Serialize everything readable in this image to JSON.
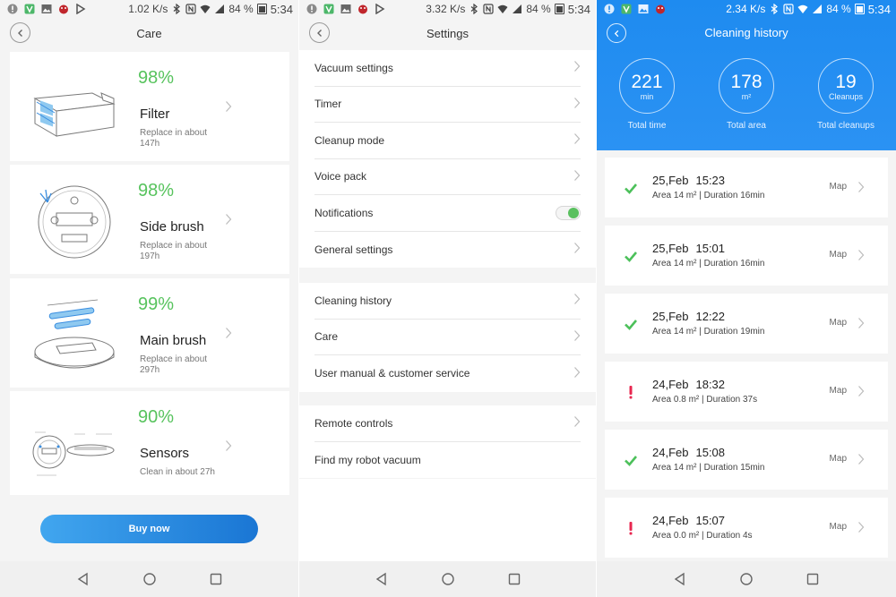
{
  "status_bars": [
    {
      "speed": "1.02 K/s",
      "battery": "84 %",
      "time": "5:34"
    },
    {
      "speed": "3.32 K/s",
      "battery": "84 %",
      "time": "5:34"
    },
    {
      "speed": "2.34 K/s",
      "battery": "84 %",
      "time": "5:34"
    }
  ],
  "care": {
    "title": "Care",
    "items": [
      {
        "percent": "98%",
        "name": "Filter",
        "sub": "Replace in about 147h"
      },
      {
        "percent": "98%",
        "name": "Side brush",
        "sub": "Replace in about 197h"
      },
      {
        "percent": "99%",
        "name": "Main brush",
        "sub": "Replace in about 297h"
      },
      {
        "percent": "90%",
        "name": "Sensors",
        "sub": "Clean in about 27h"
      }
    ],
    "buy_label": "Buy now"
  },
  "settings": {
    "title": "Settings",
    "groups": [
      [
        "Vacuum settings",
        "Timer",
        "Cleanup mode",
        "Voice pack",
        "Notifications",
        "General settings"
      ],
      [
        "Cleaning history",
        "Care",
        "User manual & customer service"
      ],
      [
        "Remote controls",
        "Find my robot vacuum"
      ]
    ],
    "notifications_on": true
  },
  "history": {
    "title": "Cleaning history",
    "stats": [
      {
        "value": "221",
        "unit": "min",
        "caption": "Total time"
      },
      {
        "value": "178",
        "unit": "m²",
        "caption": "Total area"
      },
      {
        "value": "19",
        "unit": "Cleanups",
        "caption": "Total cleanups"
      }
    ],
    "entries": [
      {
        "date": "25,Feb",
        "time": "15:23",
        "meta": "Area 14 m²  |  Duration 16min",
        "status": "ok",
        "map": "Map"
      },
      {
        "date": "25,Feb",
        "time": "15:01",
        "meta": "Area 14 m²  |  Duration 16min",
        "status": "ok",
        "map": "Map"
      },
      {
        "date": "25,Feb",
        "time": "12:22",
        "meta": "Area 14 m²  |  Duration 19min",
        "status": "ok",
        "map": "Map"
      },
      {
        "date": "24,Feb",
        "time": "18:32",
        "meta": "Area 0.8 m²  |  Duration 37s",
        "status": "warn",
        "map": "Map"
      },
      {
        "date": "24,Feb",
        "time": "15:08",
        "meta": "Area 14 m²  |  Duration 15min",
        "status": "ok",
        "map": "Map"
      },
      {
        "date": "24,Feb",
        "time": "15:07",
        "meta": "Area 0.0 m²  |  Duration 4s",
        "status": "warn",
        "map": "Map"
      }
    ]
  },
  "colors": {
    "accent_green": "#57c35d",
    "accent_blue": "#1e8bf0",
    "warn_red": "#e8264f"
  }
}
